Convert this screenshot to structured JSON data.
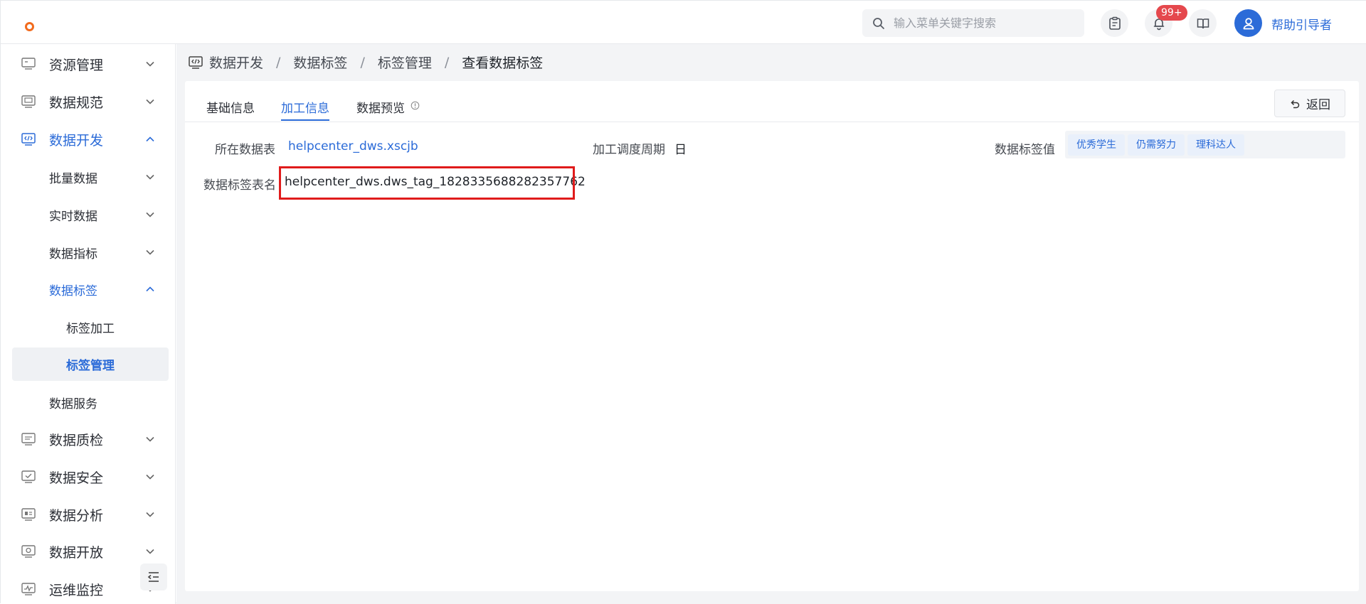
{
  "header": {
    "search_placeholder": "输入菜单关键字搜索",
    "notification_badge": "99+",
    "username": "帮助引导者",
    "brand_color": "#f26b1d",
    "accent_color": "#2b6bd8"
  },
  "sidebar": {
    "items": [
      {
        "label": "资源管理",
        "icon": "server-icon"
      },
      {
        "label": "数据规范",
        "icon": "monitor-icon"
      },
      {
        "label": "数据开发",
        "icon": "code-icon"
      },
      {
        "label": "批量数据"
      },
      {
        "label": "实时数据"
      },
      {
        "label": "数据指标"
      },
      {
        "label": "数据标签"
      },
      {
        "label": "标签加工"
      },
      {
        "label": "标签管理"
      },
      {
        "label": "数据服务"
      },
      {
        "label": "数据质检",
        "icon": "monitor-icon"
      },
      {
        "label": "数据安全",
        "icon": "shield-check-icon"
      },
      {
        "label": "数据分析",
        "icon": "chart-icon"
      },
      {
        "label": "数据开放",
        "icon": "open-icon"
      },
      {
        "label": "运维监控",
        "icon": "pulse-icon"
      }
    ]
  },
  "breadcrumb": {
    "items": [
      "数据开发",
      "数据标签",
      "标签管理",
      "查看数据标签"
    ],
    "separator": "/"
  },
  "tabs": [
    {
      "label": "基础信息"
    },
    {
      "label": "加工信息"
    },
    {
      "label": "数据预览"
    }
  ],
  "back_label": "返回",
  "fields": {
    "source_table_label": "所在数据表",
    "source_table_value": "helpcenter_dws.xscjb",
    "schedule_label": "加工调度周期",
    "schedule_value": "日",
    "tag_values_label": "数据标签值",
    "tag_values": [
      "优秀学生",
      "仍需努力",
      "理科达人"
    ],
    "tag_table_label": "数据标签表名",
    "tag_table_value": "helpcenter_dws.dws_tag_1828335688282357762"
  }
}
